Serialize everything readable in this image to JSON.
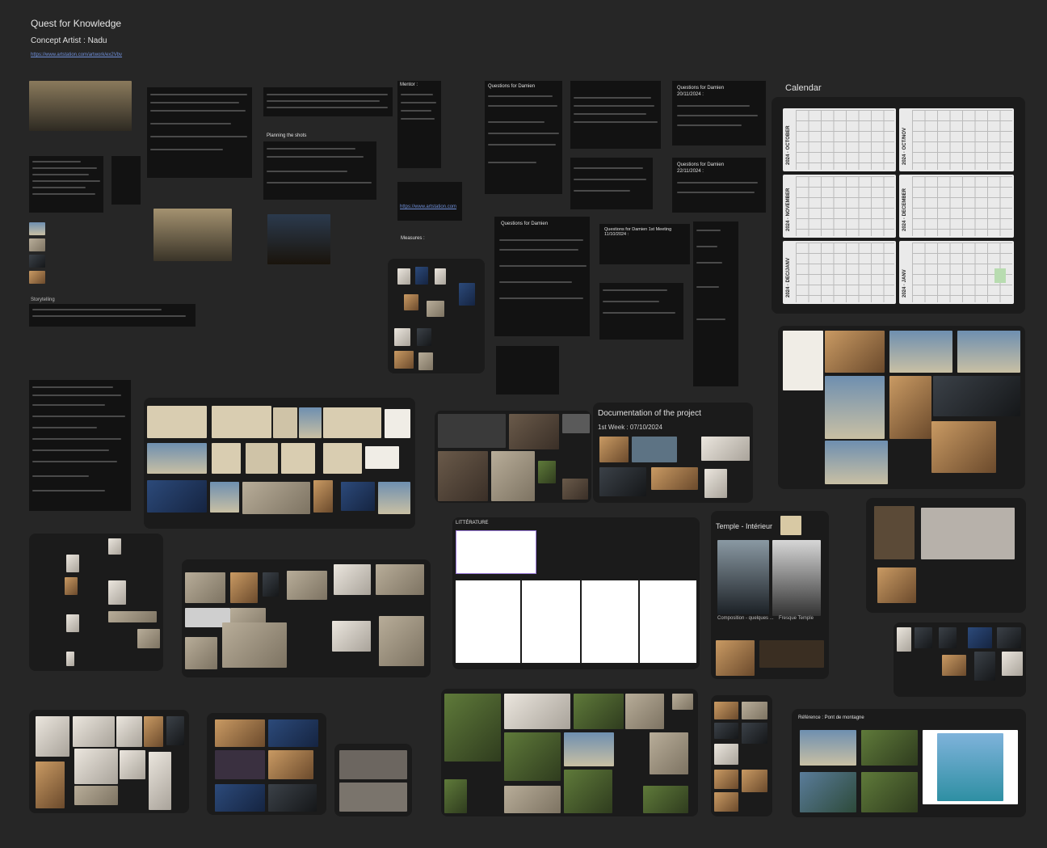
{
  "header": {
    "title": "Quest for Knowledge",
    "subtitle": "Concept Artist : Nadu",
    "link": "https://www.artstation.com/artwork/ex2Vbv"
  },
  "notes": {
    "mentor": "Mentor :",
    "planning": "Planning the shots",
    "measures": "Measures :",
    "questions_1": "Questions for Damien",
    "questions_2": "Questions for Damien",
    "questions_3": "Questions for Damien",
    "questions_4": "Questions for Damien",
    "questions_3_date": "20/11/2024 :",
    "questions_4_date": "22/11/2024 :",
    "questions_meeting": "Questions for Damien 1st Meeting 11/10/2024 :",
    "measures_links": "https://www.artstation.com",
    "storytelling": "Storytelling"
  },
  "calendar": {
    "title": "Calendar",
    "months": [
      "2024 · OCTOBER",
      "2024 · OCT/NOV",
      "2024 · NOVEMBER",
      "2024 · DECEMBER",
      "2024 · DEC/JANV",
      "2024 · JANV"
    ]
  },
  "boards": {
    "documentation_title": "Documentation of the project",
    "documentation_week": "1st Week : 07/10/2024",
    "temple_title": "Temple - Intérieur",
    "temple_caption_1": "Composition - quelques ...",
    "temple_caption_2": "Fresque Temple",
    "reference_title": "Référence : Pont de montagne",
    "literature_title": "LITTÉRATURE"
  },
  "colors": {
    "canvas": "#262626",
    "panel": "#1b1b1b",
    "link": "#6f8fd8"
  }
}
